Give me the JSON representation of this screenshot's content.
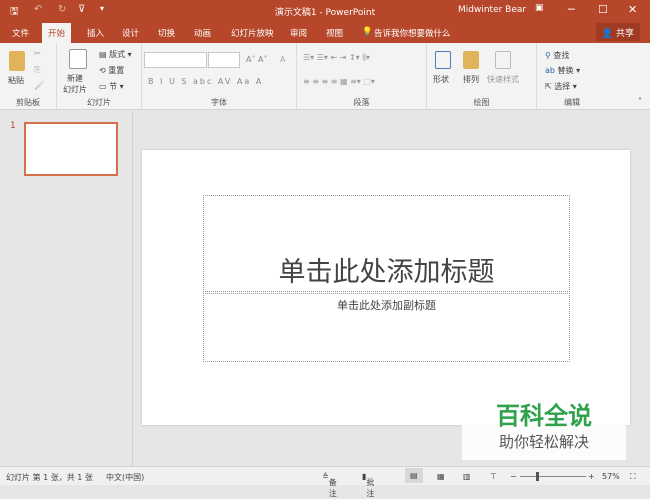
{
  "window": {
    "title": "演示文稿1 - PowerPoint",
    "user": "Midwinter Bear"
  },
  "tabs": [
    {
      "label": "文件"
    },
    {
      "label": "开始"
    },
    {
      "label": "插入"
    },
    {
      "label": "设计"
    },
    {
      "label": "切换"
    },
    {
      "label": "动画"
    },
    {
      "label": "幻灯片放映"
    },
    {
      "label": "审阅"
    },
    {
      "label": "视图"
    }
  ],
  "tell_me": "告诉我你想要做什么",
  "share": "共享",
  "ribbon": {
    "clipboard": {
      "label": "剪贴板",
      "paste": "粘贴"
    },
    "slides": {
      "label": "幻灯片",
      "new_slide": "新建\n幻灯片",
      "layout": "版式",
      "reset": "重置",
      "section": "节"
    },
    "font": {
      "label": "字体",
      "buttons": [
        "B",
        "I",
        "U",
        "S",
        "abc",
        "AV",
        "Aa",
        "A"
      ]
    },
    "paragraph": {
      "label": "段落"
    },
    "drawing": {
      "label": "绘图",
      "shapes": "形状",
      "arrange": "排列",
      "quick_styles": "快速样式"
    },
    "editing": {
      "label": "编辑",
      "find": "查找",
      "replace": "替换",
      "select": "选择"
    }
  },
  "thumbnail": {
    "number": "1"
  },
  "slide": {
    "title_placeholder": "单击此处添加标题",
    "subtitle_placeholder": "单击此处添加副标题"
  },
  "status": {
    "slide_info": "幻灯片 第 1 张，共 1 张",
    "language": "中文(中国)",
    "notes": "备注",
    "comments": "批注",
    "zoom": "57%",
    "zoom_level": 57
  },
  "watermark": {
    "brand": "百科全说",
    "slogan": "助你轻松解决"
  },
  "colors": {
    "accent": "#b7472a",
    "thumb_border": "#d5704f"
  }
}
